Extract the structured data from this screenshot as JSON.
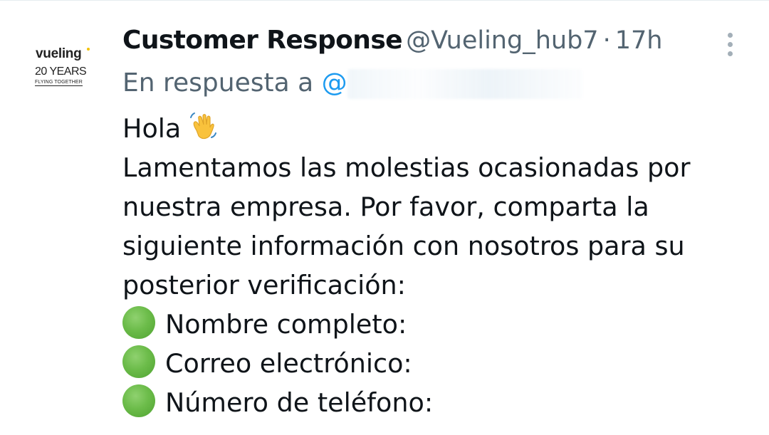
{
  "tweet": {
    "author": {
      "name": "Customer Response",
      "handle": "@Vueling_hub7",
      "separator": "·",
      "timestamp": "17h"
    },
    "avatar": {
      "logo_word": "vueling",
      "logo_years": "20 YEARS",
      "logo_tagline": "FLYING TOGETHER"
    },
    "reply_to": {
      "prefix": "En respuesta a",
      "mention_at": "@"
    },
    "body": {
      "greeting": "Hola",
      "lines": [
        "Lamentamos las molestias ocasionadas por",
        "nuestra empresa. Por favor, comparta la",
        "siguiente información con nosotros para su",
        "posterior verificación:"
      ],
      "fields": [
        "Nombre completo:",
        "Correo electrónico:",
        "Número de teléfono:"
      ]
    },
    "icons": {
      "greeting_emoji": "waving-hand-icon",
      "bullet": "green-circle-icon",
      "menu": "more-options-icon"
    },
    "colors": {
      "text": "#0f1419",
      "secondary": "#536471",
      "link": "#1d9bf0",
      "bullet": "#6cbc4a"
    }
  }
}
